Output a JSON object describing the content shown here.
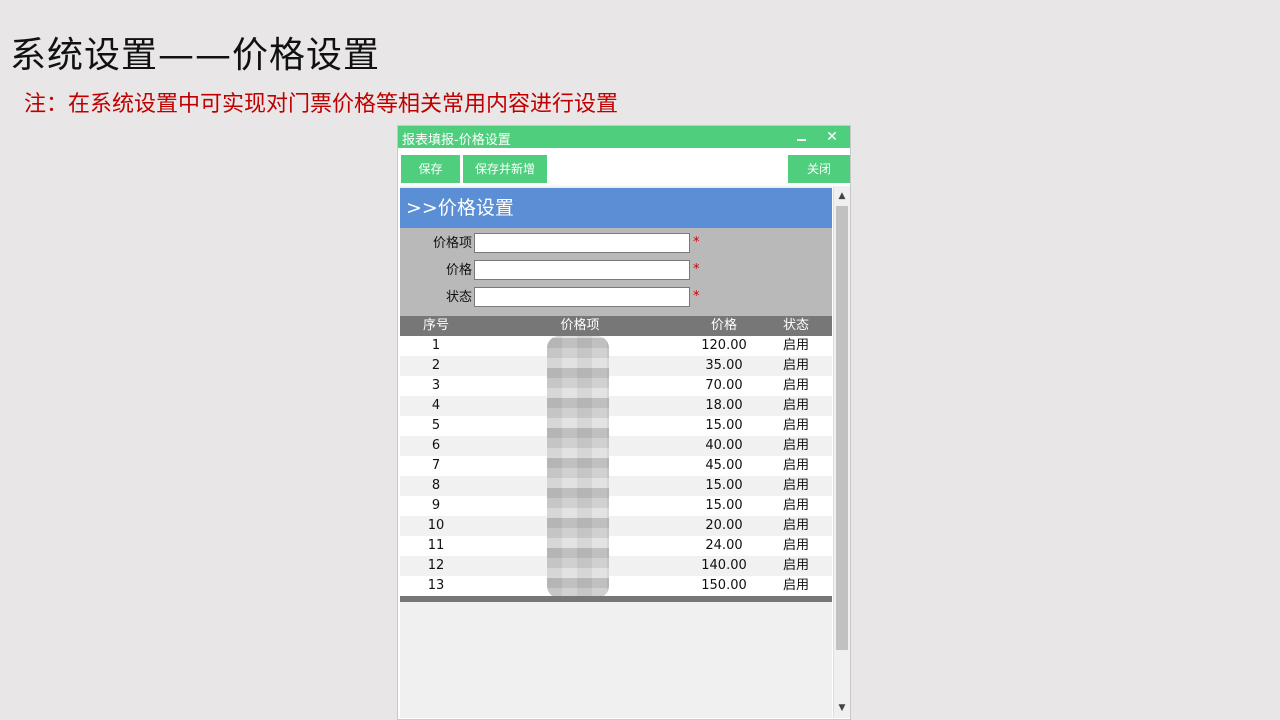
{
  "slide": {
    "title": "系统设置——价格设置",
    "note": "注：在系统设置中可实现对门票价格等相关常用内容进行设置"
  },
  "window": {
    "title": "报表填报-价格设置",
    "minimize_icon": "minimize-icon",
    "close_glyph": "✕",
    "toolbar": {
      "save_label": "保存",
      "save_new_label": "保存并新增",
      "close_label": "关闭"
    },
    "section_title": ">>价格设置",
    "form": {
      "fields": [
        {
          "label": "价格项",
          "value": "",
          "required": "*"
        },
        {
          "label": "价格",
          "value": "",
          "required": "*"
        },
        {
          "label": "状态",
          "value": "",
          "required": "*"
        }
      ]
    },
    "table": {
      "headers": {
        "index": "序号",
        "item": "价格项",
        "price": "价格",
        "status": "状态"
      },
      "rows": [
        {
          "index": "1",
          "item": "",
          "price": "120.00",
          "status": "启用"
        },
        {
          "index": "2",
          "item": "",
          "price": "35.00",
          "status": "启用"
        },
        {
          "index": "3",
          "item": "",
          "price": "70.00",
          "status": "启用"
        },
        {
          "index": "4",
          "item": "",
          "price": "18.00",
          "status": "启用"
        },
        {
          "index": "5",
          "item": "",
          "price": "15.00",
          "status": "启用"
        },
        {
          "index": "6",
          "item": "",
          "price": "40.00",
          "status": "启用"
        },
        {
          "index": "7",
          "item": "",
          "price": "45.00",
          "status": "启用"
        },
        {
          "index": "8",
          "item": "",
          "price": "15.00",
          "status": "启用"
        },
        {
          "index": "9",
          "item": "",
          "price": "15.00",
          "status": "启用"
        },
        {
          "index": "10",
          "item": "",
          "price": "20.00",
          "status": "启用"
        },
        {
          "index": "11",
          "item": "",
          "price": "24.00",
          "status": "启用"
        },
        {
          "index": "12",
          "item": "",
          "price": "140.00",
          "status": "启用"
        },
        {
          "index": "13",
          "item": "",
          "price": "150.00",
          "status": "启用"
        }
      ]
    },
    "scroll": {
      "up_glyph": "▲",
      "down_glyph": "▼"
    }
  },
  "colors": {
    "accent_green": "#4fcf7e",
    "section_blue": "#5b8fd5",
    "note_red": "#c00000"
  }
}
